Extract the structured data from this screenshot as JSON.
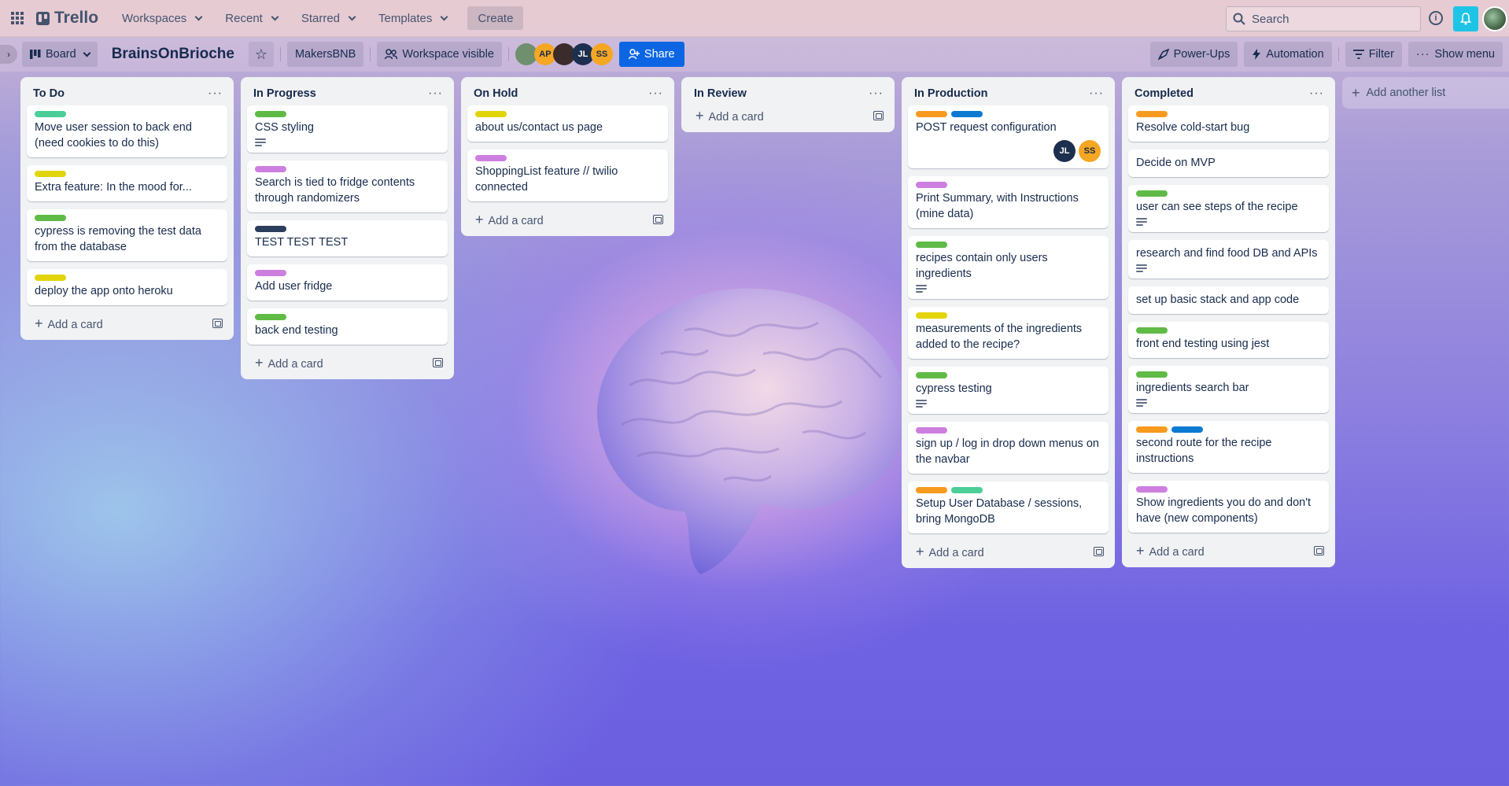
{
  "topnav": {
    "app_name": "Trello",
    "menus": [
      {
        "label": "Workspaces"
      },
      {
        "label": "Recent"
      },
      {
        "label": "Starred"
      },
      {
        "label": "Templates"
      }
    ],
    "create_label": "Create",
    "search_placeholder": "Search",
    "icons": {
      "apps": "grid-icon",
      "info": "info-icon",
      "notifications": "bell-icon"
    }
  },
  "board_header": {
    "view_label": "Board",
    "title": "BrainsOnBrioche",
    "workspace": "MakersBNB",
    "visibility_label": "Workspace visible",
    "members": [
      {
        "initials": "",
        "color": "#6f8f6f"
      },
      {
        "initials": "AP",
        "color": "#f5a623"
      },
      {
        "initials": "",
        "color": "#3b2b2b"
      },
      {
        "initials": "JL",
        "color": "#1d2f4e"
      },
      {
        "initials": "SS",
        "color": "#f5a623"
      }
    ],
    "share_label": "Share",
    "powerups_label": "Power-Ups",
    "automation_label": "Automation",
    "filter_label": "Filter",
    "show_menu_label": "Show menu"
  },
  "add_card_label": "Add a card",
  "add_list_label": "Add another list",
  "colors": {
    "green": "#4bce97",
    "lime": "#7bc86c",
    "yellow": "#f5cd47",
    "purple": "#cd8de5",
    "navy": "#2c3e5d",
    "orange": "#fea362",
    "blue": "#0c66e4"
  },
  "lists": [
    {
      "title": "To Do",
      "cards": [
        {
          "title": "Move user session to back end (need cookies to do this)",
          "labels": [
            "#4bce97"
          ],
          "desc": false
        },
        {
          "title": "Extra feature: In the mood for...",
          "labels": [
            "#e2d40b"
          ],
          "desc": false
        },
        {
          "title": "cypress is removing the test data from the database",
          "labels": [
            "#5fbb46"
          ],
          "desc": false
        },
        {
          "title": "deploy the app onto heroku",
          "labels": [
            "#e2d40b"
          ],
          "desc": false
        }
      ]
    },
    {
      "title": "In Progress",
      "cards": [
        {
          "title": "CSS styling",
          "labels": [
            "#5fbb46"
          ],
          "desc": true
        },
        {
          "title": "Search is tied to fridge contents through randomizers",
          "labels": [
            "#cd7fe0"
          ],
          "desc": false
        },
        {
          "title": "TEST TEST TEST",
          "labels": [
            "#2c3e5d"
          ],
          "desc": false
        },
        {
          "title": "Add user fridge",
          "labels": [
            "#cd7fe0"
          ],
          "desc": false
        },
        {
          "title": "back end testing",
          "labels": [
            "#5fbb46"
          ],
          "desc": false
        }
      ]
    },
    {
      "title": "On Hold",
      "cards": [
        {
          "title": "about us/contact us page",
          "labels": [
            "#e2d40b"
          ],
          "desc": false
        },
        {
          "title": "ShoppingList feature // twilio connected",
          "labels": [
            "#cd7fe0"
          ],
          "desc": false
        }
      ]
    },
    {
      "title": "In Review",
      "cards": []
    },
    {
      "title": "In Production",
      "cards": [
        {
          "title": "POST request configuration",
          "labels": [
            "#f79a1f",
            "#0c7ad1"
          ],
          "desc": false,
          "members": [
            {
              "initials": "JL",
              "color": "#1d2f4e",
              "text": "#ffffff"
            },
            {
              "initials": "SS",
              "color": "#f5a623",
              "text": "#172b4d"
            }
          ]
        },
        {
          "title": "Print Summary, with Instructions (mine data)",
          "labels": [
            "#cd7fe0"
          ],
          "desc": false
        },
        {
          "title": "recipes contain only users ingredients",
          "labels": [
            "#5fbb46"
          ],
          "desc": true
        },
        {
          "title": "measurements of the ingredients added to the recipe?",
          "labels": [
            "#e2d40b"
          ],
          "desc": false
        },
        {
          "title": "cypress testing",
          "labels": [
            "#5fbb46"
          ],
          "desc": true
        },
        {
          "title": "sign up / log in drop down menus on the navbar",
          "labels": [
            "#cd7fe0"
          ],
          "desc": false
        },
        {
          "title": "Setup User Database / sessions, bring MongoDB",
          "labels": [
            "#f79a1f",
            "#4bce97"
          ],
          "desc": false
        }
      ]
    },
    {
      "title": "Completed",
      "cards": [
        {
          "title": "Resolve cold-start bug",
          "labels": [
            "#f79a1f"
          ],
          "desc": false
        },
        {
          "title": "Decide on MVP",
          "labels": [],
          "desc": false
        },
        {
          "title": "user can see steps of the recipe",
          "labels": [
            "#5fbb46"
          ],
          "desc": true
        },
        {
          "title": "research and find food DB and APIs",
          "labels": [],
          "desc": true
        },
        {
          "title": "set up basic stack and app code",
          "labels": [],
          "desc": false
        },
        {
          "title": "front end testing using jest",
          "labels": [
            "#5fbb46"
          ],
          "desc": false
        },
        {
          "title": "ingredients search bar",
          "labels": [
            "#5fbb46"
          ],
          "desc": true
        },
        {
          "title": "second route for the recipe instructions",
          "labels": [
            "#f79a1f",
            "#0c7ad1"
          ],
          "desc": false
        },
        {
          "title": "Show ingredients you do and don't have (new components)",
          "labels": [
            "#cd7fe0"
          ],
          "desc": false
        }
      ]
    }
  ]
}
